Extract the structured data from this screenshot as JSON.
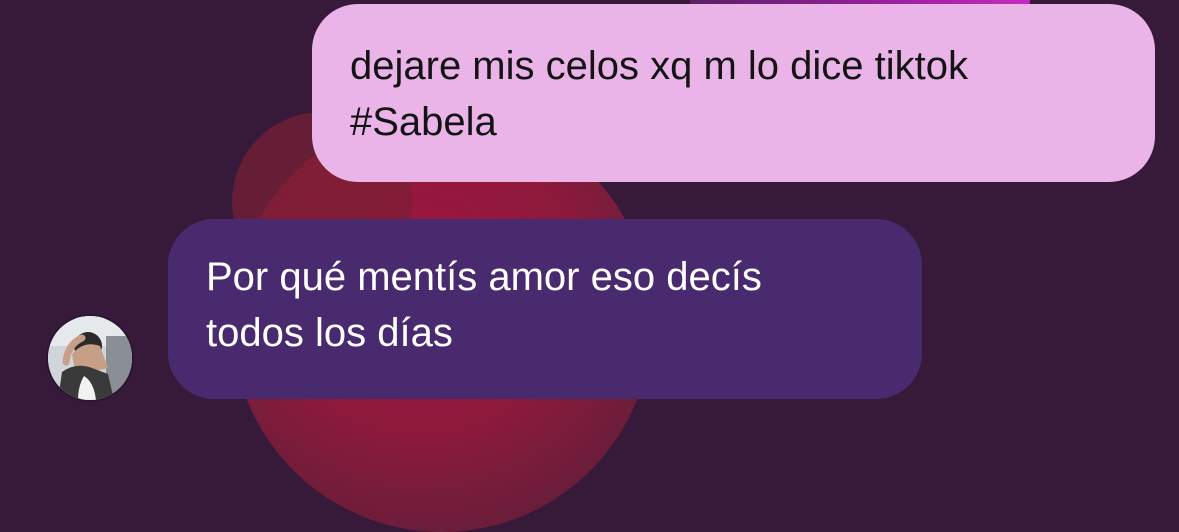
{
  "conversation": {
    "messages": [
      {
        "sender": "me",
        "lines": [
          "dejare mis celos xq m lo dice tiktok",
          "#Sabela"
        ]
      },
      {
        "sender": "other",
        "lines": [
          "Por qué mentís amor eso decís",
          "todos los días"
        ]
      }
    ],
    "avatar_icon": "user-photo-avatar"
  },
  "colors": {
    "background": "#371a3a",
    "outgoing_bubble": "#eab4e9",
    "incoming_bubble": "#4a2a6f",
    "accent_blob": "#a01441"
  }
}
